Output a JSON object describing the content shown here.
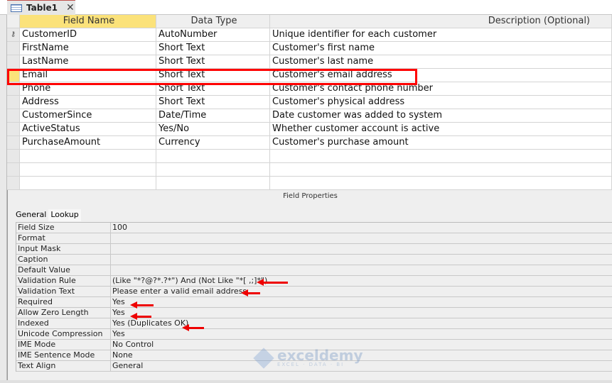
{
  "tab": {
    "title": "Table1",
    "close": "✕"
  },
  "columns": [
    "Field Name",
    "Data Type",
    "Description (Optional)"
  ],
  "rows": [
    {
      "name": "CustomerID",
      "type": "AutoNumber",
      "desc": "Unique identifier for each customer"
    },
    {
      "name": "FirstName",
      "type": "Short Text",
      "desc": "Customer's first name"
    },
    {
      "name": "LastName",
      "type": "Short Text",
      "desc": "Customer's last name"
    },
    {
      "name": "Email",
      "type": "Short Text",
      "desc": "Customer's email address"
    },
    {
      "name": "Phone",
      "type": "Short Text",
      "desc": "Customer's contact phone number"
    },
    {
      "name": "Address",
      "type": "Short Text",
      "desc": "Customer's physical address"
    },
    {
      "name": "CustomerSince",
      "type": "Date/Time",
      "desc": "Date customer was added to system"
    },
    {
      "name": "ActiveStatus",
      "type": "Yes/No",
      "desc": "Whether customer account is active"
    },
    {
      "name": "PurchaseAmount",
      "type": "Currency",
      "desc": "Customer's purchase amount"
    }
  ],
  "field_properties": {
    "title": "Field Properties",
    "tabs": [
      "General",
      "Lookup"
    ],
    "props": [
      {
        "label": "Field Size",
        "value": "100"
      },
      {
        "label": "Format",
        "value": ""
      },
      {
        "label": "Input Mask",
        "value": ""
      },
      {
        "label": "Caption",
        "value": ""
      },
      {
        "label": "Default Value",
        "value": ""
      },
      {
        "label": "Validation Rule",
        "value": "(Like \"*?@?*.?*\") And (Not Like \"*[ ,;]*\")"
      },
      {
        "label": "Validation Text",
        "value": "Please enter a valid email address"
      },
      {
        "label": "Required",
        "value": "Yes"
      },
      {
        "label": "Allow Zero Length",
        "value": "Yes"
      },
      {
        "label": "Indexed",
        "value": "Yes (Duplicates OK)"
      },
      {
        "label": "Unicode Compression",
        "value": "Yes"
      },
      {
        "label": "IME Mode",
        "value": "No Control"
      },
      {
        "label": "IME Sentence Mode",
        "value": "None"
      },
      {
        "label": "Text Align",
        "value": "General"
      }
    ]
  },
  "watermark": {
    "name": "exceldemy",
    "tagline": "EXCEL · DATA · BI"
  }
}
